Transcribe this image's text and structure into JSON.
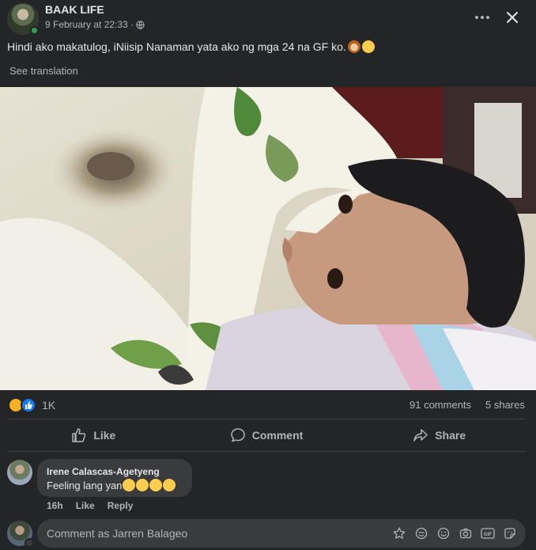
{
  "post": {
    "author": "BAAK LIFE",
    "timestamp": "9 February at 22:33 ·",
    "text": "Hindi ako makatulog, iNiisip Nanaman yata ako ng mga 24 na GF ko.",
    "see_translation": "See translation"
  },
  "stats": {
    "reactions": "1K",
    "comments": "91 comments",
    "shares": "5 shares"
  },
  "actions": {
    "like": "Like",
    "comment": "Comment",
    "share": "Share"
  },
  "comment": {
    "author": "Irene Calascas-Agetyeng",
    "text": "Feeling lang yan",
    "time": "16h",
    "like": "Like",
    "reply": "Reply"
  },
  "composer": {
    "placeholder": "Comment as Jarren Balageo"
  },
  "icons": {
    "header": [
      "globe-icon",
      "more-icon",
      "close-icon"
    ],
    "reactions": [
      "haha-icon",
      "like-icon"
    ],
    "composer": [
      "avatar-sticker-icon",
      "emoji-icon",
      "smile-icon",
      "camera-icon",
      "gif-icon",
      "sticker-icon"
    ]
  },
  "colors": {
    "background": "#242526",
    "surface": "#3a3b3c",
    "text_primary": "#e4e6eb",
    "text_secondary": "#b0b3b8",
    "like_blue": "#1877f2",
    "online_green": "#31a24c"
  }
}
